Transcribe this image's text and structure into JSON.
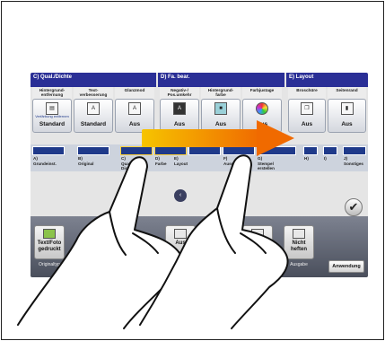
{
  "screen": {
    "headers": [
      {
        "key": "qual",
        "text": "C)  Qual./Dichte"
      },
      {
        "key": "fa",
        "text": "D)  Fa. bear."
      },
      {
        "key": "layout",
        "text": "E)  Layout"
      }
    ],
    "categories": [
      "Hintergrund-\nentfernung",
      "Text-\nverbesserung",
      "Glanzmod",
      "Negativ-/\nPos.umkehr",
      "Hintergrund-\nfarbe",
      "Farbjustage",
      "Broschüre",
      "Seitenrand"
    ],
    "buttons": [
      {
        "icon": "doc-icon",
        "label": "Standard",
        "sub": "Verfärbung entfernen"
      },
      {
        "icon": "text-icon",
        "label": "Standard",
        "sub": ""
      },
      {
        "icon": "gloss-icon",
        "label": "Aus",
        "sub": ""
      },
      {
        "icon": "invert-icon",
        "label": "Aus",
        "sub": ""
      },
      {
        "icon": "bgcolor-icon",
        "label": "Aus",
        "sub": ""
      },
      {
        "icon": "colorwheel-icon",
        "label": "Aus",
        "sub": ""
      },
      {
        "icon": "booklet-icon",
        "label": "Aus",
        "sub": ""
      },
      {
        "icon": "margin-icon",
        "label": "Aus",
        "sub": ""
      }
    ],
    "strip_labels": [
      "A)\nGrundeinst.",
      "B)\nOriginal",
      "C)\nQual./\nDichte",
      "D)\nFarbe",
      "E)\nLayout",
      "F)\nAusgabe",
      "G)\nStempel\nerstellen",
      "H)",
      "I)",
      "J)\nSonstiges"
    ],
    "bottom_buttons": [
      {
        "label": "Text/Foto\ngedruckt",
        "group": "Originaltyp"
      },
      {
        "label": "Aus",
        "group": "Papier"
      },
      {
        "label": "Aus",
        "group": "Duplex/\nKombinieren"
      },
      {
        "label": "Nicht\nheften",
        "group": "Ausgabe"
      }
    ],
    "apply_label": "Anwendung",
    "nav_left": "‹",
    "confirm": "✔",
    "colors": {
      "header": "#2a2f96",
      "arrow_start": "#f6c400",
      "arrow_end": "#f06a00"
    }
  }
}
